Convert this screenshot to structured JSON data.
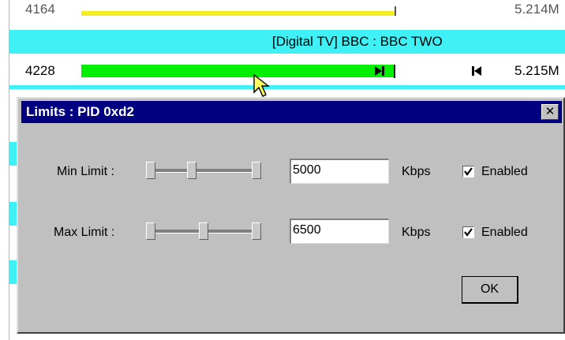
{
  "rows": [
    {
      "id": "4164",
      "rate": "5.214M"
    },
    {
      "id": "4228",
      "rate": "5.215M"
    }
  ],
  "channel": {
    "title": "[Digital TV] BBC : BBC TWO"
  },
  "colors": {
    "yellow_bar": "#f5ec22",
    "green_bar": "#00ee00",
    "cyan_band": "#3ff0f4",
    "titlebar": "#000080"
  },
  "dialog": {
    "title": "Limits : PID 0xd2",
    "close_glyph": "✕",
    "min": {
      "label": "Min Limit :",
      "value": "5000",
      "unit": "Kbps",
      "enabled_label": "Enabled",
      "enabled": true
    },
    "max": {
      "label": "Max Limit :",
      "value": "6500",
      "unit": "Kbps",
      "enabled_label": "Enabled",
      "enabled": true
    },
    "ok_label": "OK"
  },
  "icons": {
    "cursor": "arrow-cursor-icon",
    "marker_right": "marker-right-icon",
    "marker_left": "marker-left-icon"
  }
}
